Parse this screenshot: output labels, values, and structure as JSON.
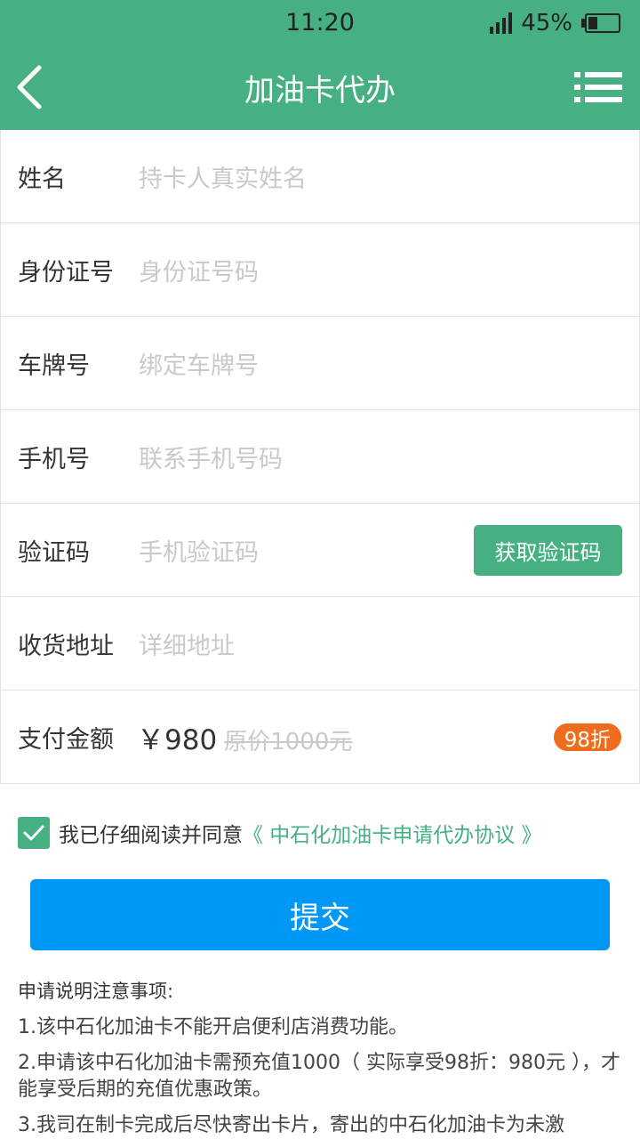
{
  "status_bar": {
    "time": "11:20",
    "battery": "45%"
  },
  "nav": {
    "title": "加油卡代办"
  },
  "form": {
    "rows": [
      {
        "label": "姓名",
        "placeholder": "持卡人真实姓名"
      },
      {
        "label": "身份证号",
        "placeholder": "身份证号码"
      },
      {
        "label": "车牌号",
        "placeholder": "绑定车牌号"
      },
      {
        "label": "手机号",
        "placeholder": "联系手机号码"
      },
      {
        "label": "验证码",
        "placeholder": "手机验证码"
      },
      {
        "label": "收货地址",
        "placeholder": "详细地址"
      }
    ],
    "get_code_label": "获取验证码",
    "payment": {
      "label": "支付金额",
      "amount": "￥980",
      "original_price": "原价1000元",
      "discount_badge": "98折"
    }
  },
  "agreement": {
    "text": "我已仔细阅读并同意",
    "link": "《 中石化加油卡申请代办协议 》",
    "checked": true
  },
  "submit_label": "提交",
  "notes": {
    "title": "申请说明注意事项:",
    "items": [
      "1.该中石化加油卡不能开启便利店消费功能。",
      "2.申请该中石化加油卡需预充值1000（ 实际享受98折：980元 ），才能享受后期的充值优惠政策。",
      "3.我司在制卡完成后尽快寄出卡片，寄出的中石化加油卡为未激"
    ]
  },
  "colors": {
    "brand_green": "#46b083",
    "submit_blue": "#0098f6",
    "discount_orange": "#ef6c1d"
  }
}
